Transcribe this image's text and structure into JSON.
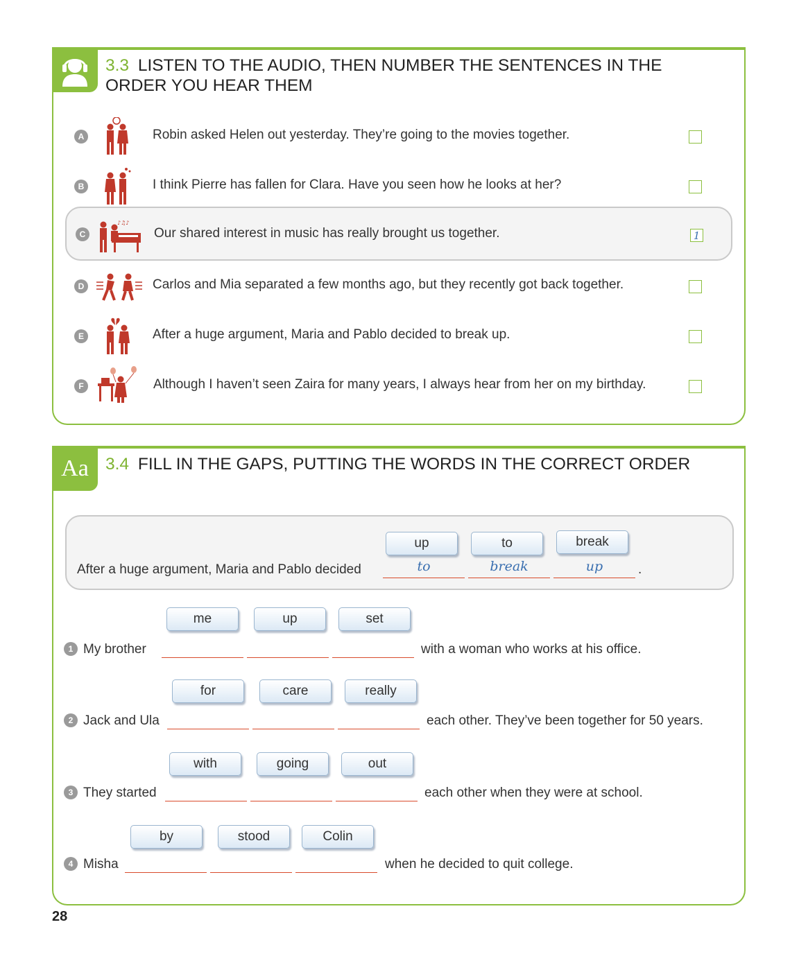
{
  "ex33": {
    "number": "3.3",
    "title": "LISTEN TO THE AUDIO, THEN NUMBER THE SENTENCES IN THE ORDER YOU HEAR THEM",
    "icon": "headphones-person-icon",
    "items": [
      {
        "letter": "A",
        "text": "Robin asked Helen out yesterday. They’re going to the movies together.",
        "answer": ""
      },
      {
        "letter": "B",
        "text": "I think Pierre has fallen for Clara. Have you seen how he looks at her?",
        "answer": ""
      },
      {
        "letter": "C",
        "text": "Our shared interest in music has really brought us together.",
        "answer": "1"
      },
      {
        "letter": "D",
        "text": "Carlos and Mia separated a few months ago, but they recently got back together.",
        "answer": ""
      },
      {
        "letter": "E",
        "text": "After a huge argument, Maria and Pablo decided to break up.",
        "answer": ""
      },
      {
        "letter": "F",
        "text": "Although I haven’t seen Zaira for many years, I always hear from her on my birthday.",
        "answer": ""
      }
    ]
  },
  "ex34": {
    "number": "3.4",
    "badge": "Aa",
    "title": "FILL IN THE GAPS, PUTTING THE WORDS IN THE CORRECT ORDER",
    "example": {
      "words": [
        "up",
        "to",
        "break"
      ],
      "before": "After a huge argument, Maria and Pablo decided",
      "answers": [
        "to",
        "break",
        "up"
      ],
      "after": "."
    },
    "questions": [
      {
        "num": "1",
        "words": [
          "me",
          "up",
          "set"
        ],
        "before": "My brother",
        "after": "with a woman who works at his office."
      },
      {
        "num": "2",
        "words": [
          "for",
          "care",
          "really"
        ],
        "before": "Jack and Ula",
        "after": "each other. They’ve been together for 50 years."
      },
      {
        "num": "3",
        "words": [
          "with",
          "going",
          "out"
        ],
        "before": "They started",
        "after": "each other when they were at school."
      },
      {
        "num": "4",
        "words": [
          "by",
          "stood",
          "Colin"
        ],
        "before": "Misha",
        "after": "when he decided to quit college."
      }
    ]
  },
  "page_number": "28",
  "colors": {
    "accent_green": "#8cbf3f",
    "figure_red": "#c0392b",
    "blank_line": "#d94b2b",
    "handwriting_blue": "#3a6fb0"
  }
}
